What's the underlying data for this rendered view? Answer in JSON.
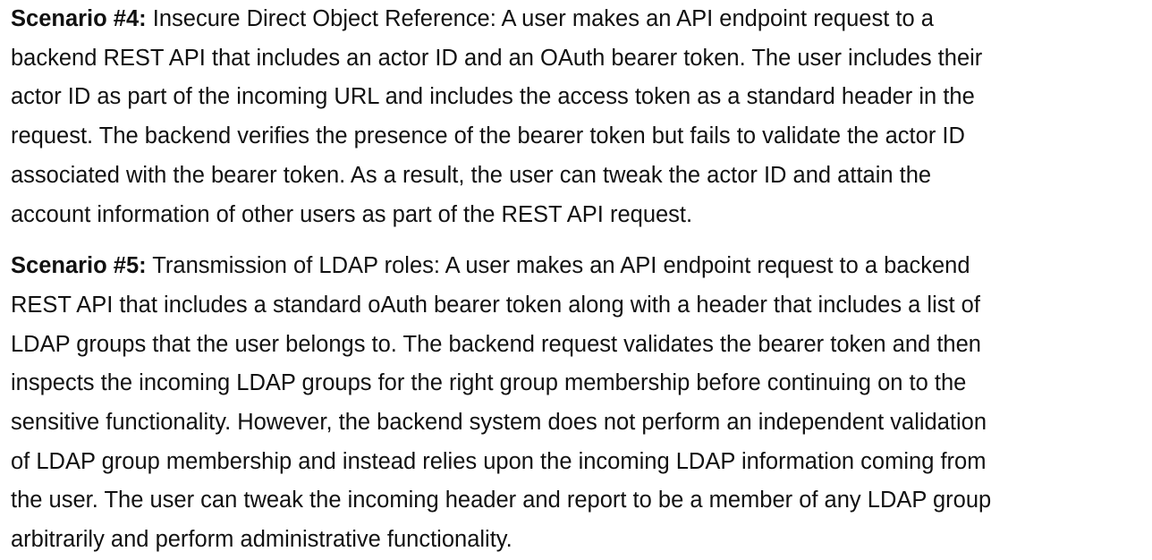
{
  "scenarios": [
    {
      "label": "Scenario #4:",
      "lines": [
        " Insecure Direct Object Reference: A user makes an API endpoint request to a",
        "backend REST API that includes an actor ID and an OAuth bearer token. The user includes their",
        "actor ID as part of the incoming URL and includes the access token as a standard header in the",
        "request. The backend verifies the presence of the bearer token but fails to validate the actor ID",
        "associated with the bearer token. As a result, the user can tweak the actor ID and attain the",
        "account information of other users as part of the REST API request."
      ]
    },
    {
      "label": "Scenario #5:",
      "lines": [
        " Transmission of LDAP roles: A user makes an API endpoint request to a backend",
        "REST API that includes a standard oAuth bearer token along with a header that includes a list of",
        "LDAP groups that the user belongs to. The backend request validates the bearer token and then",
        "inspects the incoming LDAP groups for the right group membership before continuing on to the",
        "sensitive functionality. However, the backend system does not perform an independent validation",
        "of LDAP group membership and instead relies upon the incoming LDAP information coming from",
        "the user. The user can tweak the incoming header and report to be a member of any LDAP group",
        "arbitrarily and perform administrative functionality."
      ]
    }
  ]
}
